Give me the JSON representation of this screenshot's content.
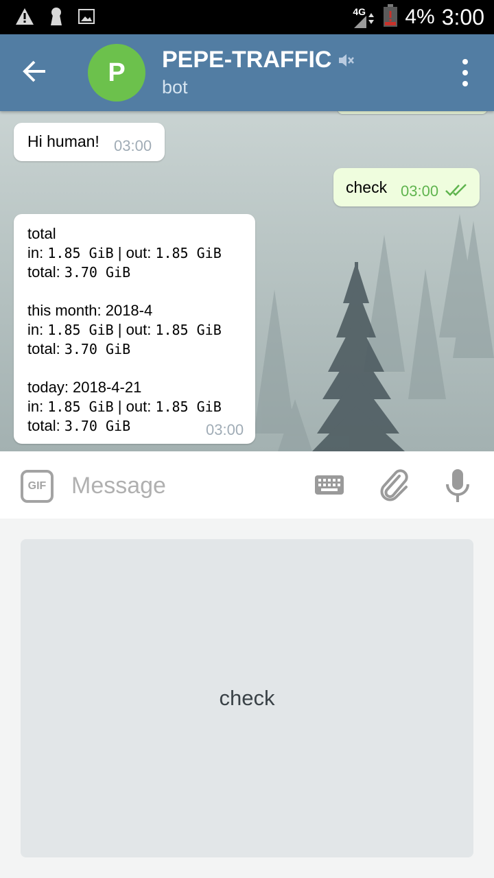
{
  "status_bar": {
    "network": "4G",
    "battery": "4%",
    "time": "3:00",
    "icons": [
      "warning-icon",
      "keyhole-icon",
      "image-icon",
      "signal-icon",
      "battery-icon"
    ]
  },
  "toolbar": {
    "avatar_letter": "P",
    "title": "PEPE-TRAFFIC",
    "subtitle": "bot",
    "avatar_color": "#6cc14c",
    "bar_color": "#527da3"
  },
  "messages": [
    {
      "direction": "in",
      "text": "Hi human!",
      "time": "03:00"
    },
    {
      "direction": "out",
      "text": "check",
      "time": "03:00",
      "status": "read"
    },
    {
      "direction": "in",
      "time": "03:00",
      "lines": [
        {
          "label": "total",
          "value": ""
        },
        {
          "label": "in: ",
          "value": "1.85 GiB",
          "label2": " | out: ",
          "value2": "1.85 GiB"
        },
        {
          "label": "total: ",
          "value": "3.70 GiB"
        },
        {
          "label": "",
          "value": ""
        },
        {
          "label": "this month: 2018-4",
          "value": ""
        },
        {
          "label": "in: ",
          "value": "1.85 GiB",
          "label2": " | out: ",
          "value2": "1.85 GiB"
        },
        {
          "label": "total: ",
          "value": "3.70 GiB"
        },
        {
          "label": "",
          "value": ""
        },
        {
          "label": "today: 2018-4-21",
          "value": ""
        },
        {
          "label": "in: ",
          "value": "1.85 GiB",
          "label2": " | out: ",
          "value2": "1.85 GiB"
        },
        {
          "label": "total: ",
          "value": "3.70 GiB"
        }
      ]
    }
  ],
  "composer": {
    "gif_label": "GIF",
    "placeholder": "Message",
    "value": ""
  },
  "bot_keyboard": {
    "button_label": "check"
  }
}
